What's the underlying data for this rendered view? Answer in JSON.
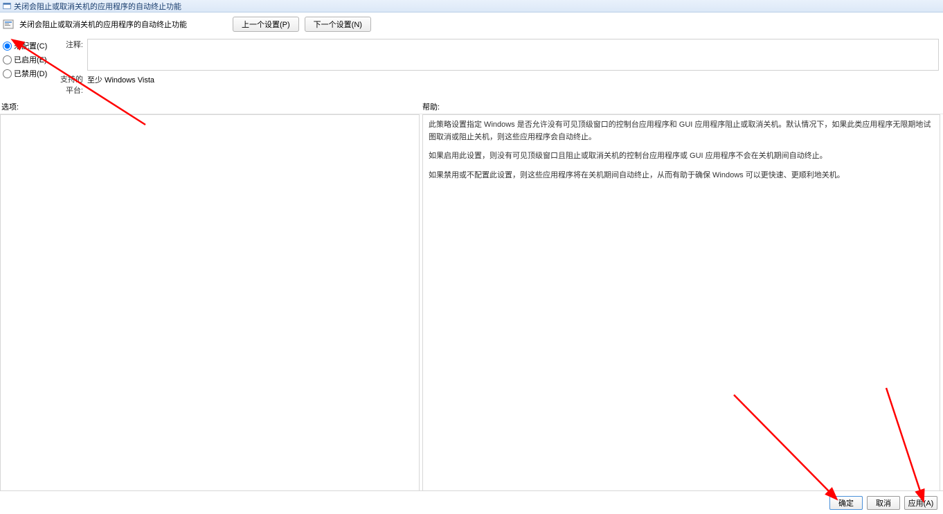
{
  "window": {
    "title": "关闭会阻止或取消关机的应用程序的自动终止功能"
  },
  "header": {
    "policy_title": "关闭会阻止或取消关机的应用程序的自动终止功能",
    "prev_btn": "上一个设置(P)",
    "next_btn": "下一个设置(N)"
  },
  "radios": {
    "not_configured": "未配置(C)",
    "enabled": "已启用(E)",
    "disabled": "已禁用(D)"
  },
  "info": {
    "comment_label": "注释:",
    "platform_label": "支持的平台:",
    "platform_value": "至少 Windows Vista"
  },
  "panels": {
    "options_label": "选项:",
    "help_label": "帮助:"
  },
  "help": {
    "p1": "此策略设置指定 Windows 是否允许没有可见顶级窗口的控制台应用程序和 GUI 应用程序阻止或取消关机。默认情况下，如果此类应用程序无限期地试图取消或阻止关机，则这些应用程序会自动终止。",
    "p2": "如果启用此设置，则没有可见顶级窗口且阻止或取消关机的控制台应用程序或 GUI 应用程序不会在关机期间自动终止。",
    "p3": "如果禁用或不配置此设置，则这些应用程序将在关机期间自动终止，从而有助于确保 Windows 可以更快速、更顺利地关机。"
  },
  "footer": {
    "ok": "确定",
    "cancel": "取消",
    "apply": "应用(A)"
  }
}
